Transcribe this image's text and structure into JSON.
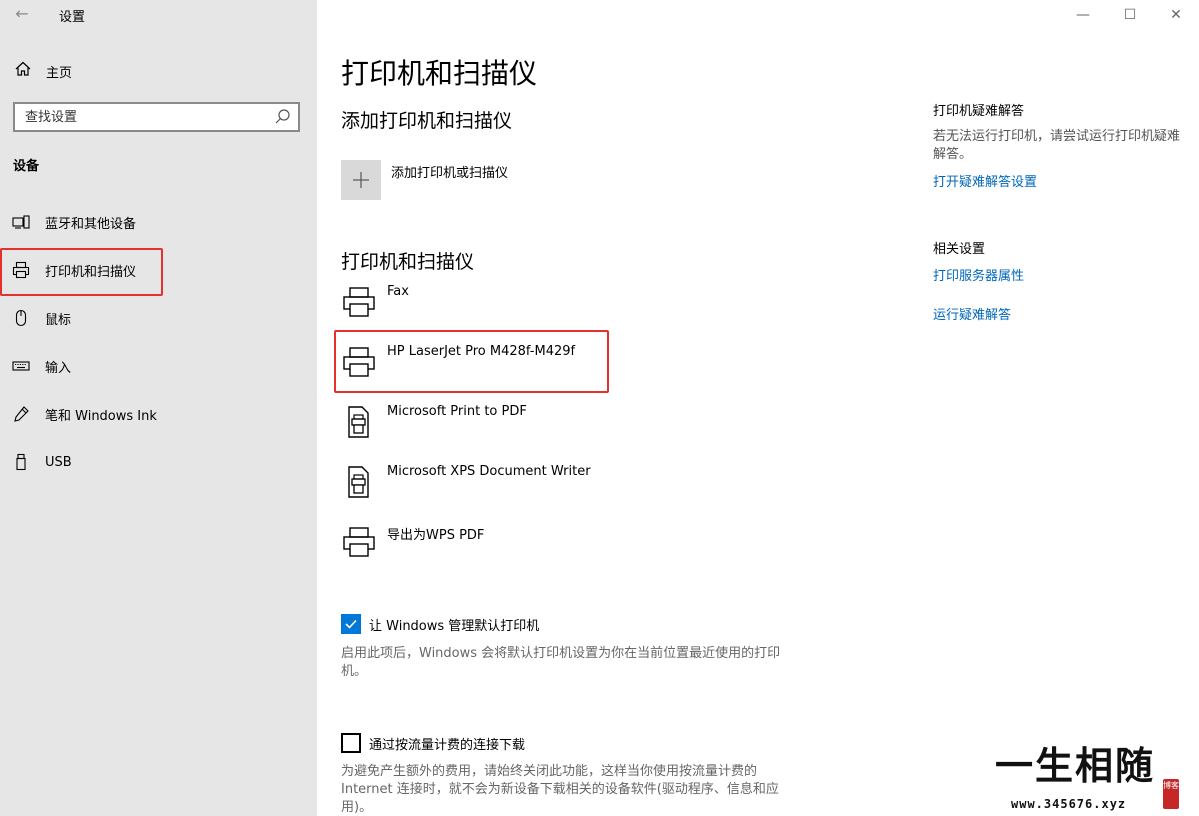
{
  "window": {
    "title": "设置",
    "controls": {
      "minimize": "—",
      "maximize": "☐",
      "close": "✕"
    }
  },
  "sidebar": {
    "home_label": "主页",
    "search_placeholder": "查找设置",
    "section": "设备",
    "items": [
      {
        "label": "蓝牙和其他设备",
        "icon": "bluetooth-devices-icon"
      },
      {
        "label": "打印机和扫描仪",
        "icon": "printer-icon",
        "selected": true
      },
      {
        "label": "鼠标",
        "icon": "mouse-icon"
      },
      {
        "label": "输入",
        "icon": "keyboard-icon"
      },
      {
        "label": "笔和 Windows Ink",
        "icon": "pen-icon"
      },
      {
        "label": "USB",
        "icon": "usb-icon"
      }
    ]
  },
  "main": {
    "title": "打印机和扫描仪",
    "add_section_title": "添加打印机和扫描仪",
    "add_button_label": "添加打印机或扫描仪",
    "list_title": "打印机和扫描仪",
    "printers": [
      {
        "name": "Fax",
        "icon": "printer-icon"
      },
      {
        "name": "HP LaserJet Pro M428f-M429f",
        "icon": "printer-icon"
      },
      {
        "name": "Microsoft Print to PDF",
        "icon": "document-printer-icon"
      },
      {
        "name": "Microsoft XPS Document Writer",
        "icon": "document-printer-icon"
      },
      {
        "name": "导出为WPS PDF",
        "icon": "printer-icon"
      }
    ],
    "manage_default": {
      "label": "让 Windows 管理默认打印机",
      "checked": true,
      "description": "启用此项后，Windows 会将默认打印机设置为你在当前位置最近使用的打印机。"
    },
    "metered": {
      "label": "通过按流量计费的连接下载",
      "checked": false,
      "description": "为避免产生额外的费用，请始终关闭此功能，这样当你使用按流量计费的 Internet 连接时，就不会为新设备下载相关的设备软件(驱动程序、信息和应用)。"
    }
  },
  "right": {
    "troubleshoot_title": "打印机疑难解答",
    "troubleshoot_text": "若无法运行打印机，请尝试运行打印机疑难解答。",
    "troubleshoot_link": "打开疑难解答设置",
    "related_title": "相关设置",
    "related_links": [
      "打印服务器属性",
      "运行疑难解答"
    ]
  },
  "watermark": {
    "text": "一生相随",
    "url": "www.345676.xyz",
    "seal": "博客"
  },
  "colors": {
    "sidebar_bg": "#e6e6e6",
    "accent": "#0078d7",
    "link": "#0067b8",
    "highlight_frame": "#e53030"
  }
}
